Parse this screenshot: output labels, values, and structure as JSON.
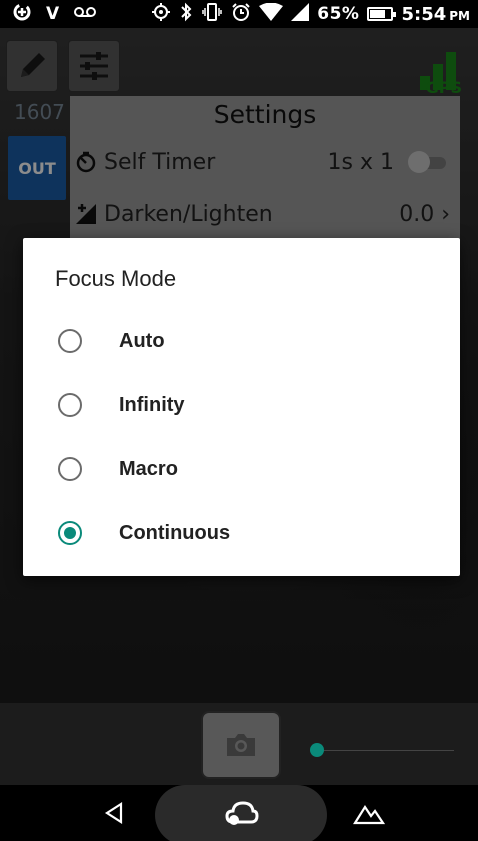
{
  "status_bar": {
    "left_icons": [
      "data-saver-icon",
      "v-icon",
      "voicemail-icon"
    ],
    "carrier_v": "V",
    "battery_percent": "65%",
    "battery_level": 0.65,
    "time": "5:54",
    "ampm": "PM"
  },
  "toolbar": {
    "count": "1607",
    "out_label": "OUT",
    "gps_label": "GPS"
  },
  "settings": {
    "title": "Settings",
    "rows": [
      {
        "label": "Self Timer",
        "value": "1s x 1",
        "icon": "timer-icon",
        "toggle": false
      },
      {
        "label": "Darken/Lighten",
        "value": "0.0 ›",
        "icon": "exposure-icon"
      }
    ]
  },
  "dialog": {
    "title": "Focus Mode",
    "options": [
      {
        "label": "Auto",
        "checked": false
      },
      {
        "label": "Infinity",
        "checked": false
      },
      {
        "label": "Macro",
        "checked": false
      },
      {
        "label": "Continuous",
        "checked": true
      }
    ]
  },
  "bottom": {
    "zoom_level": 0.0
  },
  "colors": {
    "accent": "#0a8a7a",
    "out_button": "#1a5ea8",
    "gps": "#1a8a1a"
  }
}
